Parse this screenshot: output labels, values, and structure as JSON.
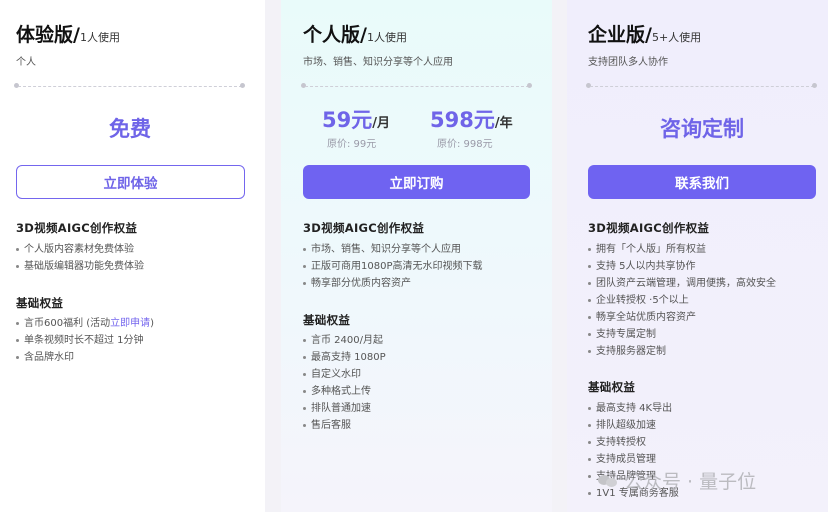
{
  "plans": {
    "trial": {
      "name": "体验版/",
      "suffix": "1人使用",
      "subtitle": "个人",
      "price_text": "免费",
      "button": "立即体验",
      "section1_title": "3D视频AIGC创作权益",
      "section1_items": [
        "个人版内容素材免费体验",
        "基础版编辑器功能免费体验"
      ],
      "section2_title": "基础权益",
      "section2_items": [
        {
          "text": "言币600福利 (活动",
          "link": "立即申请",
          "tail": ")"
        },
        {
          "text": "单条视频时长不超过 1分钟"
        },
        {
          "text": "含品牌水印"
        }
      ]
    },
    "personal": {
      "name": "个人版/",
      "suffix": "1人使用",
      "subtitle": "市场、销售、知识分享等个人应用",
      "monthly_price": "59元",
      "monthly_unit": "/月",
      "monthly_orig": "原价: 99元",
      "yearly_price": "598元",
      "yearly_unit": "/年",
      "yearly_orig": "原价: 998元",
      "button": "立即订购",
      "section1_title": "3D视频AIGC创作权益",
      "section1_items": [
        "市场、销售、知识分享等个人应用",
        "正版可商用1080P高清无水印视频下载",
        "畅享部分优质内容资产"
      ],
      "section2_title": "基础权益",
      "section2_items": [
        "言币 2400/月起",
        "最高支持 1080P",
        "自定义水印",
        "多种格式上传",
        "排队普通加速",
        "售后客服"
      ]
    },
    "enterprise": {
      "name": "企业版/",
      "suffix": "5+人使用",
      "subtitle": "支持团队多人协作",
      "price_text": "咨询定制",
      "button": "联系我们",
      "section1_title": "3D视频AIGC创作权益",
      "section1_items": [
        "拥有「个人版」所有权益",
        "支持 5人以内共享协作",
        "团队资产云端管理，调用便携，高效安全",
        "企业转授权 ·5个以上",
        "畅享全站优质内容资产",
        "支持专属定制",
        "支持服务器定制"
      ],
      "section2_title": "基础权益",
      "section2_items": [
        "最高支持 4K导出",
        "排队超级加速",
        "支持转授权",
        "支持成员管理",
        "支持品牌管理",
        "1V1 专属商务客服"
      ]
    }
  },
  "watermark": "公众号 · 量子位",
  "colors": {
    "accent": "#6f63f1",
    "price": "#6f64e8"
  }
}
